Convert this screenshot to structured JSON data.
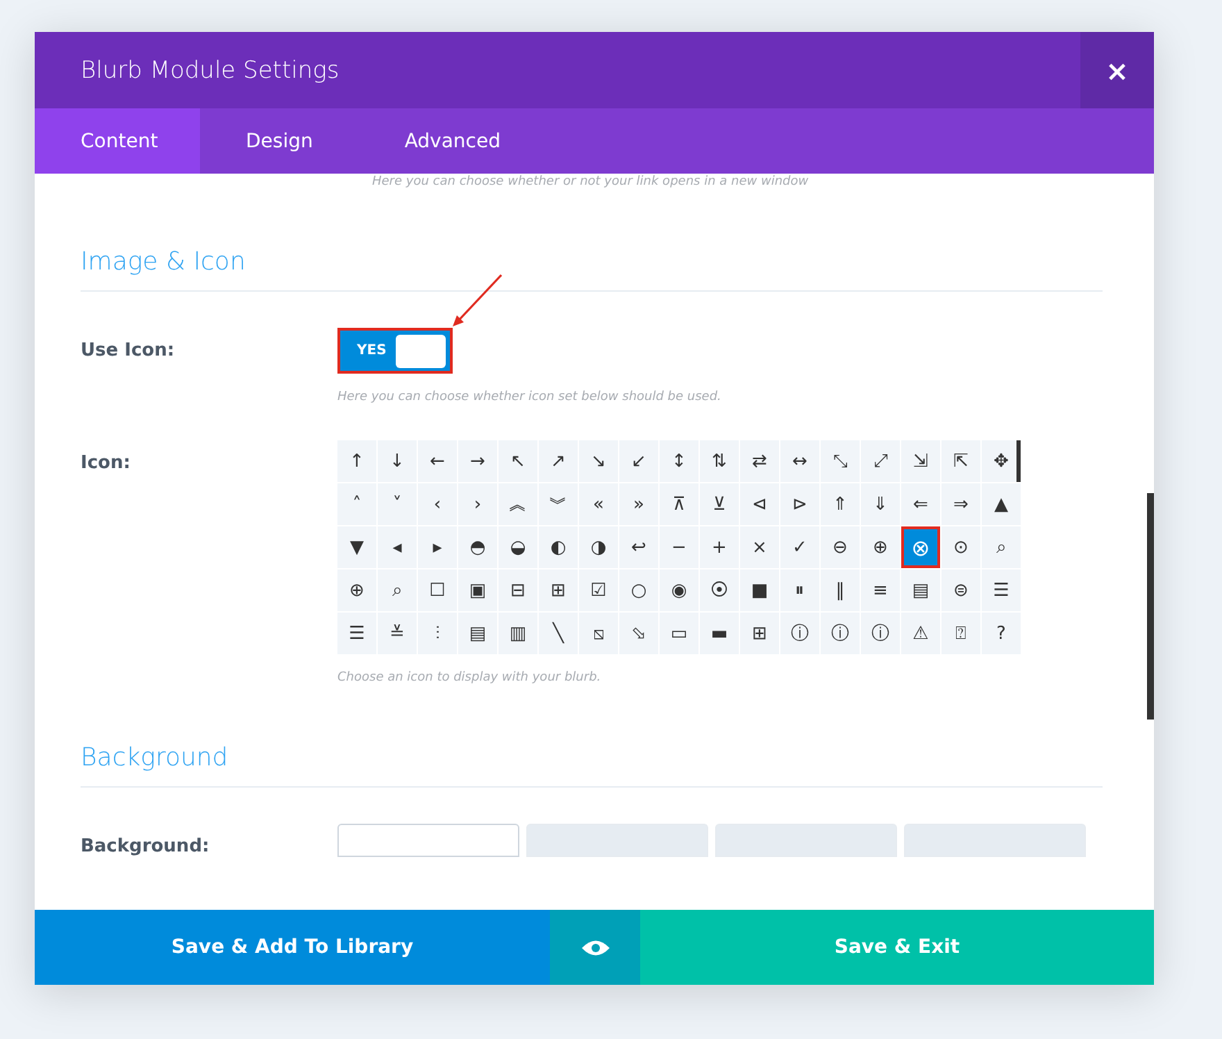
{
  "window": {
    "title": "Blurb Module Settings",
    "close": "×"
  },
  "tabs": [
    {
      "label": "Content",
      "selected": true
    },
    {
      "label": "Design",
      "selected": false
    },
    {
      "label": "Advanced",
      "selected": false
    }
  ],
  "link_hint": "Here you can choose whether or not your link opens in a new window",
  "sections": [
    {
      "heading": "Image & Icon",
      "fields": [
        {
          "kind": "toggle",
          "label": "Use Icon:",
          "on": true,
          "value": "YES",
          "hint": "Here you can choose whether icon set below should be used."
        },
        {
          "kind": "icon_grid",
          "label": "Icon:",
          "hint": "Choose an icon to display with your blurb.",
          "icons": [
            {
              "glyph": "↑",
              "selected": false
            },
            {
              "glyph": "↓",
              "selected": false
            },
            {
              "glyph": "←",
              "selected": false
            },
            {
              "glyph": "→",
              "selected": false
            },
            {
              "glyph": "↖",
              "selected": false
            },
            {
              "glyph": "↗",
              "selected": false
            },
            {
              "glyph": "↘",
              "selected": false
            },
            {
              "glyph": "↙",
              "selected": false
            },
            {
              "glyph": "↕",
              "selected": false
            },
            {
              "glyph": "⇅",
              "selected": false
            },
            {
              "glyph": "⇄",
              "selected": false
            },
            {
              "glyph": "↔",
              "selected": false
            },
            {
              "glyph": "⤡",
              "selected": false
            },
            {
              "glyph": "⤢",
              "selected": false
            },
            {
              "glyph": "⇲",
              "selected": false
            },
            {
              "glyph": "⇱",
              "selected": false
            },
            {
              "glyph": "✥",
              "selected": false
            },
            {
              "glyph": "˄",
              "selected": false
            },
            {
              "glyph": "˅",
              "selected": false
            },
            {
              "glyph": "‹",
              "selected": false
            },
            {
              "glyph": "›",
              "selected": false
            },
            {
              "glyph": "︽",
              "selected": false
            },
            {
              "glyph": "︾",
              "selected": false
            },
            {
              "glyph": "«",
              "selected": false
            },
            {
              "glyph": "»",
              "selected": false
            },
            {
              "glyph": "⊼",
              "selected": false
            },
            {
              "glyph": "⊻",
              "selected": false
            },
            {
              "glyph": "⊲",
              "selected": false
            },
            {
              "glyph": "⊳",
              "selected": false
            },
            {
              "glyph": "⇑",
              "selected": false
            },
            {
              "glyph": "⇓",
              "selected": false
            },
            {
              "glyph": "⇐",
              "selected": false
            },
            {
              "glyph": "⇒",
              "selected": false
            },
            {
              "glyph": "▲",
              "selected": false
            },
            {
              "glyph": "▼",
              "selected": false
            },
            {
              "glyph": "◂",
              "selected": false
            },
            {
              "glyph": "▸",
              "selected": false
            },
            {
              "glyph": "◓",
              "selected": false
            },
            {
              "glyph": "◒",
              "selected": false
            },
            {
              "glyph": "◐",
              "selected": false
            },
            {
              "glyph": "◑",
              "selected": false
            },
            {
              "glyph": "↩",
              "selected": false
            },
            {
              "glyph": "−",
              "selected": false
            },
            {
              "glyph": "+",
              "selected": false
            },
            {
              "glyph": "×",
              "selected": false
            },
            {
              "glyph": "✓",
              "selected": false
            },
            {
              "glyph": "⊖",
              "selected": false
            },
            {
              "glyph": "⊕",
              "selected": false
            },
            {
              "glyph": "⊗",
              "selected": true
            },
            {
              "glyph": "⊙",
              "selected": false
            },
            {
              "glyph": "⌕",
              "selected": false
            },
            {
              "glyph": "⊕",
              "selected": false
            },
            {
              "glyph": "⌕",
              "selected": false
            },
            {
              "glyph": "☐",
              "selected": false
            },
            {
              "glyph": "▣",
              "selected": false
            },
            {
              "glyph": "⊟",
              "selected": false
            },
            {
              "glyph": "⊞",
              "selected": false
            },
            {
              "glyph": "☑",
              "selected": false
            },
            {
              "glyph": "○",
              "selected": false
            },
            {
              "glyph": "◉",
              "selected": false
            },
            {
              "glyph": "⦿",
              "selected": false
            },
            {
              "glyph": "■",
              "selected": false
            },
            {
              "glyph": "⏸",
              "selected": false
            },
            {
              "glyph": "‖",
              "selected": false
            },
            {
              "glyph": "≡",
              "selected": false
            },
            {
              "glyph": "▤",
              "selected": false
            },
            {
              "glyph": "⊜",
              "selected": false
            },
            {
              "glyph": "☰",
              "selected": false
            },
            {
              "glyph": "☰",
              "selected": false
            },
            {
              "glyph": "≚",
              "selected": false
            },
            {
              "glyph": "⫶",
              "selected": false
            },
            {
              "glyph": "▤",
              "selected": false
            },
            {
              "glyph": "▥",
              "selected": false
            },
            {
              "glyph": "╲",
              "selected": false
            },
            {
              "glyph": "⧅",
              "selected": false
            },
            {
              "glyph": "⬂",
              "selected": false
            },
            {
              "glyph": "▭",
              "selected": false
            },
            {
              "glyph": "▬",
              "selected": false
            },
            {
              "glyph": "⊞",
              "selected": false
            },
            {
              "glyph": "ⓘ",
              "selected": false
            },
            {
              "glyph": "ⓘ",
              "selected": false
            },
            {
              "glyph": "ⓘ",
              "selected": false
            },
            {
              "glyph": "⚠",
              "selected": false
            },
            {
              "glyph": "⍰",
              "selected": false
            },
            {
              "glyph": "?",
              "selected": false
            }
          ]
        }
      ]
    },
    {
      "heading": "Background",
      "fields": [
        {
          "kind": "bg_tabs",
          "label": "Background:",
          "tabs": [
            {
              "selected": true
            },
            {
              "selected": false
            },
            {
              "selected": false
            },
            {
              "selected": false
            }
          ]
        }
      ]
    }
  ],
  "footer": [
    {
      "kind": "library",
      "label": "Save & Add To Library"
    },
    {
      "kind": "preview"
    },
    {
      "kind": "exit",
      "label": "Save & Exit"
    }
  ]
}
